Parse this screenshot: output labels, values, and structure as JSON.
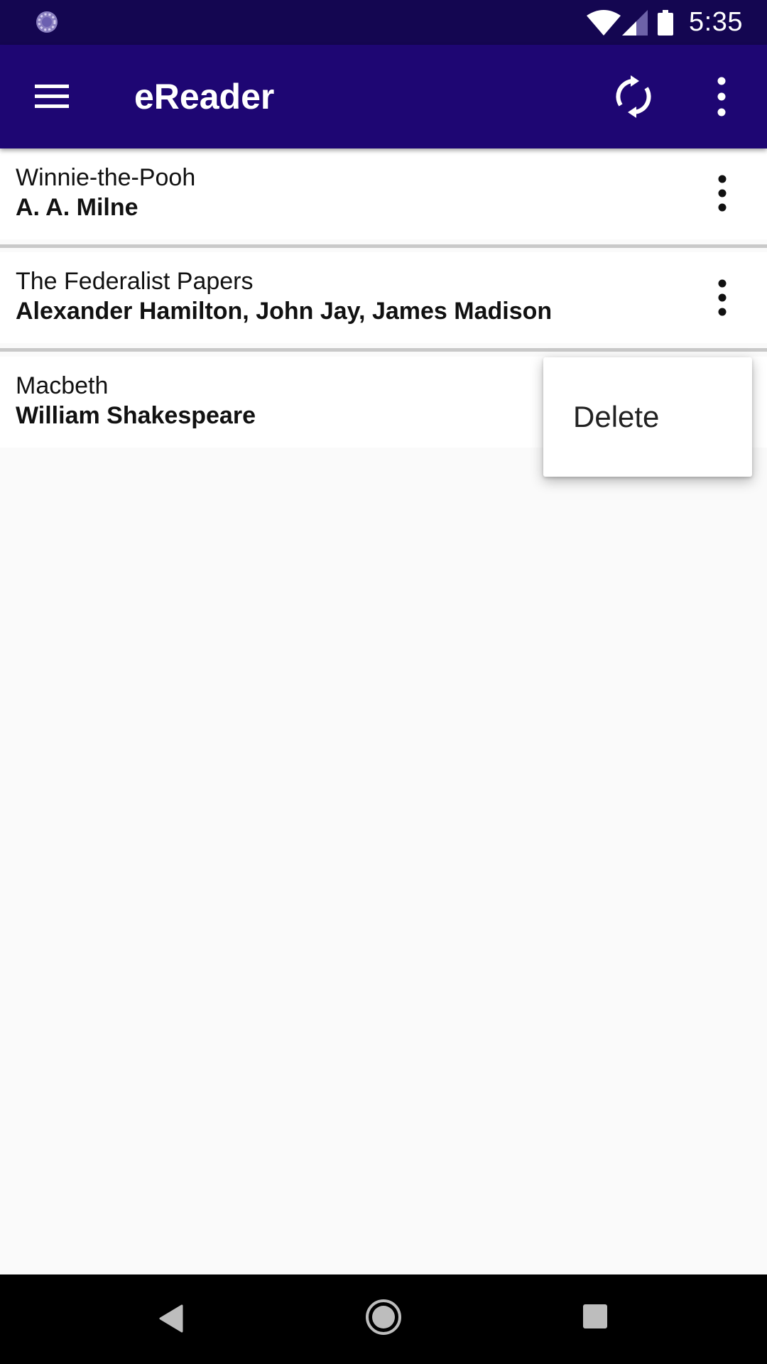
{
  "status_bar": {
    "time": "5:35",
    "icons": [
      "loading-indicator-icon",
      "wifi-icon",
      "cell-signal-icon",
      "battery-icon"
    ]
  },
  "app_bar": {
    "title": "eReader",
    "icons": [
      "menu-icon",
      "sync-icon",
      "more-vert-icon"
    ]
  },
  "books": [
    {
      "title": "Winnie-the-Pooh",
      "author": "A. A. Milne"
    },
    {
      "title": "The Federalist Papers",
      "author": "Alexander Hamilton, John Jay, James Madison"
    },
    {
      "title": "Macbeth",
      "author": "William Shakespeare"
    }
  ],
  "popup_menu": {
    "items": [
      {
        "label": "Delete"
      }
    ]
  },
  "nav_bar": {
    "icons": [
      "back-icon",
      "home-icon",
      "recents-icon"
    ]
  },
  "colors": {
    "status_bar": "#140651",
    "app_bar": "#1e0673",
    "background": "#fafafa",
    "card": "#ffffff",
    "divider": "#c9c9c9"
  }
}
